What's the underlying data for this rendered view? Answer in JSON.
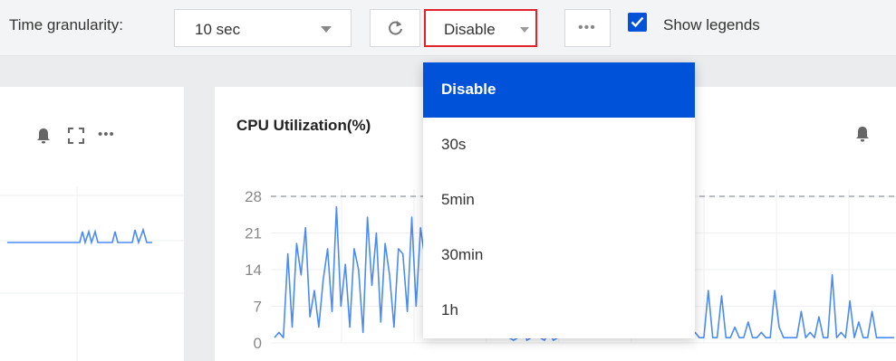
{
  "toolbar": {
    "time_granularity_label": "Time granularity:",
    "granularity_value": "10 sec",
    "auto_refresh_value": "Disable",
    "more_label": "•••",
    "show_legends_label": "Show legends",
    "show_legends_checked": true
  },
  "dropdown": {
    "options": [
      "Disable",
      "30s",
      "5min",
      "30min",
      "1h"
    ],
    "selected": "Disable"
  },
  "panels": {
    "main_title": "CPU Utilization(%)",
    "left_more": "•••"
  },
  "chart_data": {
    "type": "line",
    "title": "CPU Utilization(%)",
    "yticks": [
      "28",
      "21",
      "14",
      "7",
      "0"
    ],
    "ylim": [
      0,
      28
    ],
    "series": [
      {
        "values": [
          1,
          2,
          1,
          17,
          3,
          19,
          13,
          22,
          5,
          10,
          3,
          12,
          18,
          6,
          26,
          7,
          15,
          3,
          18,
          14,
          2,
          24,
          11,
          21,
          4,
          19,
          13,
          3,
          18,
          17,
          6,
          24,
          7,
          22,
          16,
          20,
          3,
          8,
          9,
          18,
          14,
          9,
          18,
          4,
          5,
          17,
          12,
          14,
          3,
          8,
          1,
          1,
          1,
          1,
          0.5,
          1,
          4,
          0.5,
          1,
          1,
          1,
          0.5,
          2,
          0.5,
          1,
          1,
          2,
          1,
          1,
          1,
          1,
          1,
          1,
          4,
          1,
          1,
          7,
          2,
          9,
          1,
          4,
          1,
          1,
          12,
          1,
          1,
          1,
          1,
          6,
          1,
          1,
          3,
          1,
          1,
          1,
          2,
          1,
          1,
          10,
          1,
          1,
          9,
          1,
          1,
          3,
          1,
          1,
          4,
          1,
          1,
          2,
          1,
          1,
          10,
          3,
          1,
          1,
          1,
          1,
          6,
          1,
          2,
          1,
          5,
          1,
          1,
          13,
          1,
          2,
          1,
          8,
          1,
          4,
          1,
          1,
          6,
          1,
          1,
          1,
          1,
          1
        ]
      }
    ],
    "colors": {
      "line": "#4b8bf4",
      "threshold": "#a3a6ab"
    }
  },
  "colors": {
    "accent": "#0052d9",
    "highlight_border": "#e0242a"
  }
}
